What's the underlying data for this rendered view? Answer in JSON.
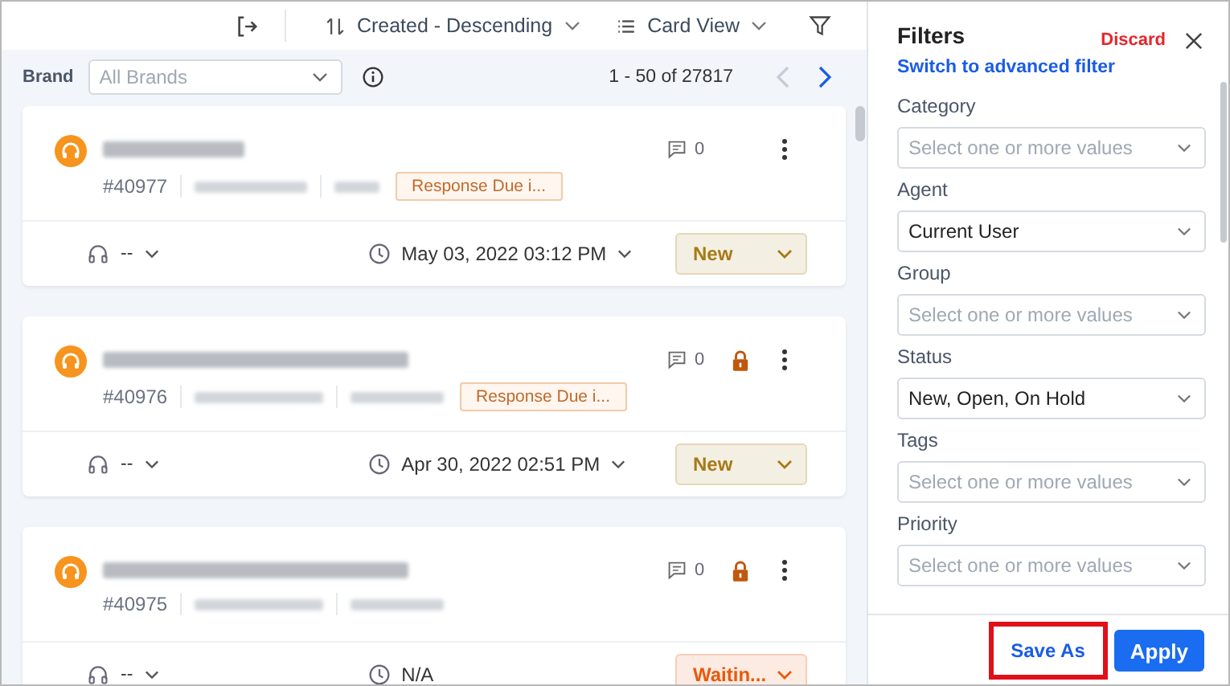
{
  "toolbar": {
    "sort": "Created - Descending",
    "view": "Card View"
  },
  "brand": {
    "label": "Brand",
    "placeholder": "All Brands"
  },
  "pagination": {
    "range": "1 - 50 of 27817",
    "prev_disabled": true,
    "next_disabled": false
  },
  "tickets": [
    {
      "id": "#40977",
      "comments": "0",
      "locked": false,
      "response_due": "Response Due i...",
      "agent": "--",
      "date": "May 03, 2022 03:12 PM",
      "date_menu": true,
      "status": "New",
      "color": "#a77a16"
    },
    {
      "id": "#40976",
      "comments": "0",
      "locked": true,
      "response_due": "Response Due i...",
      "agent": "--",
      "date": "Apr 30, 2022 02:51 PM",
      "date_menu": true,
      "status": "New",
      "color": "#a77a16"
    },
    {
      "id": "#40975",
      "comments": "0",
      "locked": true,
      "agent": "--",
      "date": "N/A",
      "date_menu": false,
      "status": "Waitin...",
      "color": "#e8590c"
    }
  ],
  "filters": {
    "title": "Filters",
    "discard": "Discard",
    "link": "Switch to advanced filter",
    "fields": [
      {
        "label": "Category",
        "placeholder": "Select one or more values"
      },
      {
        "label": "Agent",
        "value": "Current User"
      },
      {
        "label": "Group",
        "placeholder": "Select one or more values"
      },
      {
        "label": "Status",
        "value": "New, Open, On Hold"
      },
      {
        "label": "Tags",
        "placeholder": "Select one or more values"
      },
      {
        "label": "Priority",
        "placeholder": "Select one or more values"
      }
    ],
    "save_as": {
      "label": "Save As",
      "highlighted": true
    },
    "apply": "Apply"
  }
}
